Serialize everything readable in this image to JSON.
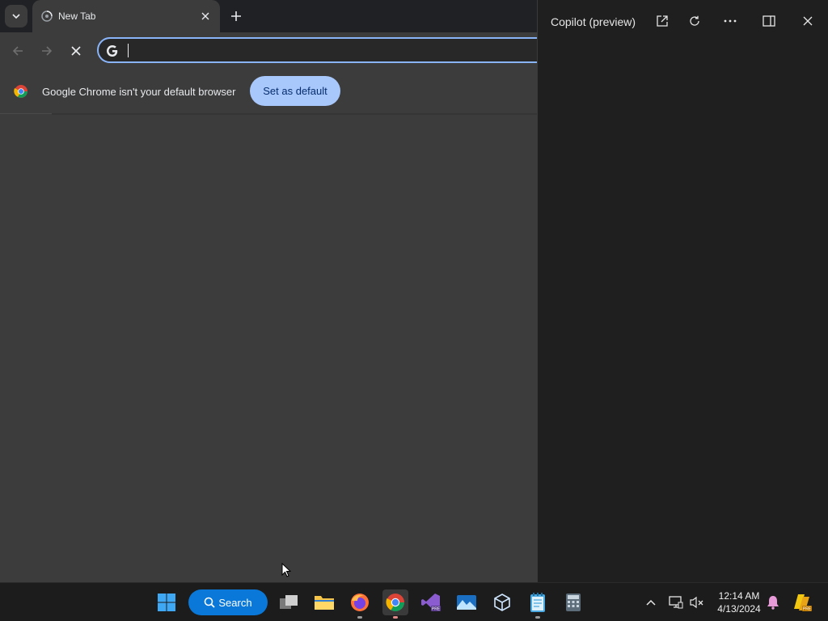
{
  "browser": {
    "tab": {
      "title": "New Tab"
    },
    "omnibox": {
      "value": "",
      "placeholder": ""
    },
    "infobar": {
      "message": "Google Chrome isn't your default browser",
      "button_label": "Set as default"
    }
  },
  "copilot": {
    "title": "Copilot (preview)"
  },
  "taskbar": {
    "search_label": "Search",
    "clock": {
      "time": "12:14 AM",
      "date": "4/13/2024"
    },
    "pinned": [
      "windows-start",
      "task-view",
      "file-explorer",
      "firefox",
      "chrome",
      "visual-studio-preview",
      "photos",
      "virtualbox",
      "notepad",
      "calculator"
    ]
  },
  "colors": {
    "accent": "#8ab4f8",
    "set_default_bg": "#a8c7fa",
    "search_pill": "#0a78d8",
    "taskbar": "#1c1c1c"
  }
}
